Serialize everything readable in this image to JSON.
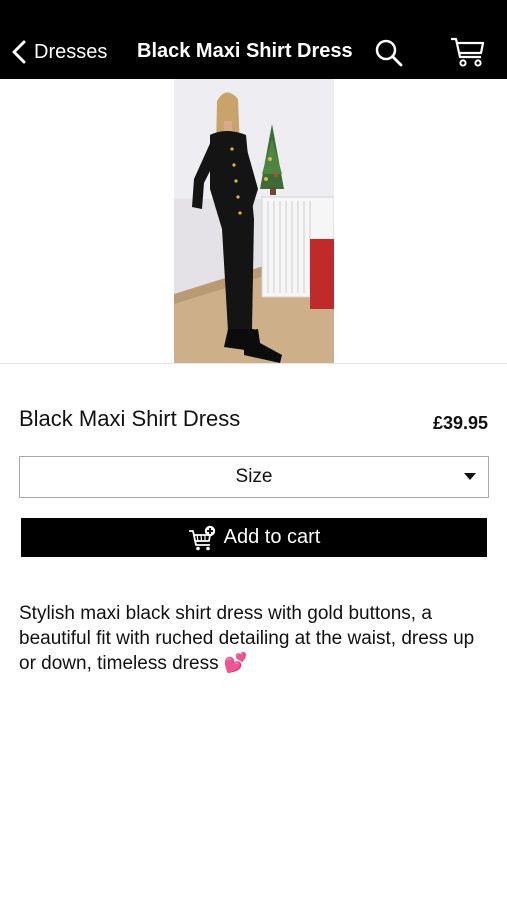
{
  "nav": {
    "back_label": "Dresses",
    "title": "Black Maxi Shirt Dress"
  },
  "product": {
    "name": "Black Maxi Shirt Dress",
    "price": "£39.95",
    "size_select_value": "Size",
    "add_to_cart_label": "Add to cart",
    "description": "Stylish maxi black shirt dress with gold buttons, a beautiful fit with ruched detailing at the waist, dress up or down, timeless dress 💕"
  },
  "colors": {
    "nav_background": "#000000",
    "button_background": "#000000",
    "page_background": "#ffffff"
  },
  "icons": [
    "chevron-left-icon",
    "search-icon",
    "cart-icon",
    "add-to-cart-icon",
    "caret-down-icon"
  ]
}
